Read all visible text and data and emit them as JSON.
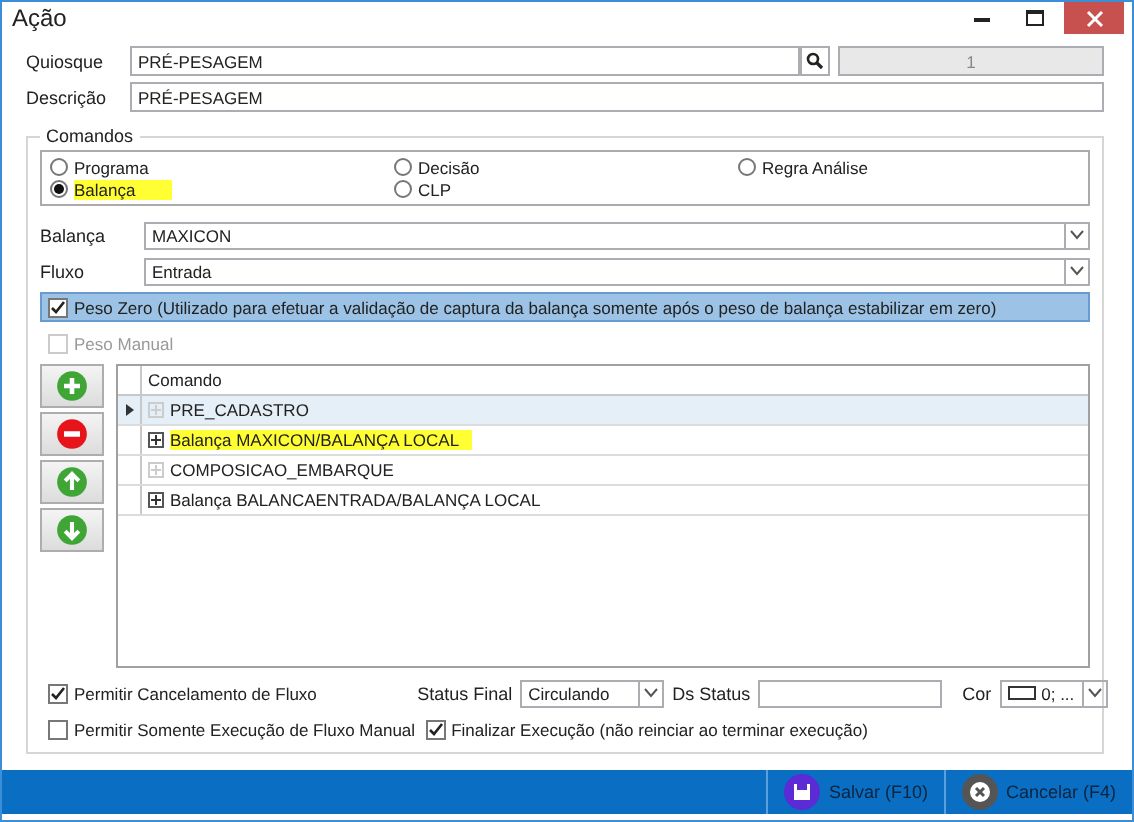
{
  "window": {
    "title": "Ação"
  },
  "quiosque": {
    "label": "Quiosque",
    "value": "PRÉ-PESAGEM",
    "code": "1"
  },
  "descricao": {
    "label": "Descrição",
    "value": "PRÉ-PESAGEM"
  },
  "comandos": {
    "title": "Comandos",
    "options": [
      {
        "label": "Programa",
        "selected": false,
        "highlighted": false
      },
      {
        "label": "Decisão",
        "selected": false,
        "highlighted": false
      },
      {
        "label": "Regra Análise",
        "selected": false,
        "highlighted": false
      },
      {
        "label": "Balança",
        "selected": true,
        "highlighted": true
      },
      {
        "label": "CLP",
        "selected": false,
        "highlighted": false
      }
    ]
  },
  "balanca": {
    "label": "Balança",
    "value": "MAXICON"
  },
  "fluxo": {
    "label": "Fluxo",
    "value": "Entrada"
  },
  "peso_zero": {
    "label": "Peso Zero (Utilizado para efetuar a validação de captura da balança somente após o peso de balança estabilizar em zero)",
    "checked": true,
    "focused": true
  },
  "peso_manual": {
    "label": "Peso Manual",
    "checked": false,
    "disabled": true
  },
  "side_buttons": [
    {
      "kind": "add"
    },
    {
      "kind": "remove"
    },
    {
      "kind": "up"
    },
    {
      "kind": "down"
    }
  ],
  "grid": {
    "column": "Comando",
    "rows": [
      {
        "label": "PRE_CADASTRO",
        "selected": true,
        "has_children": false,
        "highlighted": false
      },
      {
        "label": "Balança MAXICON/BALANÇA LOCAL",
        "selected": false,
        "has_children": true,
        "highlighted": true
      },
      {
        "label": "COMPOSICAO_EMBARQUE",
        "selected": false,
        "has_children": false,
        "highlighted": false
      },
      {
        "label": "Balança BALANCAENTRADA/BALANÇA LOCAL",
        "selected": false,
        "has_children": true,
        "highlighted": false
      }
    ]
  },
  "permitir_cancelamento": {
    "label": "Permitir Cancelamento de Fluxo",
    "checked": true
  },
  "status_final": {
    "label": "Status Final",
    "value": "Circulando"
  },
  "ds_status": {
    "label": "Ds Status"
  },
  "cor": {
    "label": "Cor",
    "value": "0; ..."
  },
  "permitir_manual": {
    "label": "Permitir Somente Execução de Fluxo Manual",
    "checked": false
  },
  "finalizar": {
    "label": "Finalizar Execução (não reinciar ao terminar execução)",
    "checked": true
  },
  "footer": {
    "buttons": [
      {
        "kind": "save",
        "label": "Salvar (F10)"
      },
      {
        "kind": "cancel",
        "label": "Cancelar (F4)"
      }
    ]
  }
}
